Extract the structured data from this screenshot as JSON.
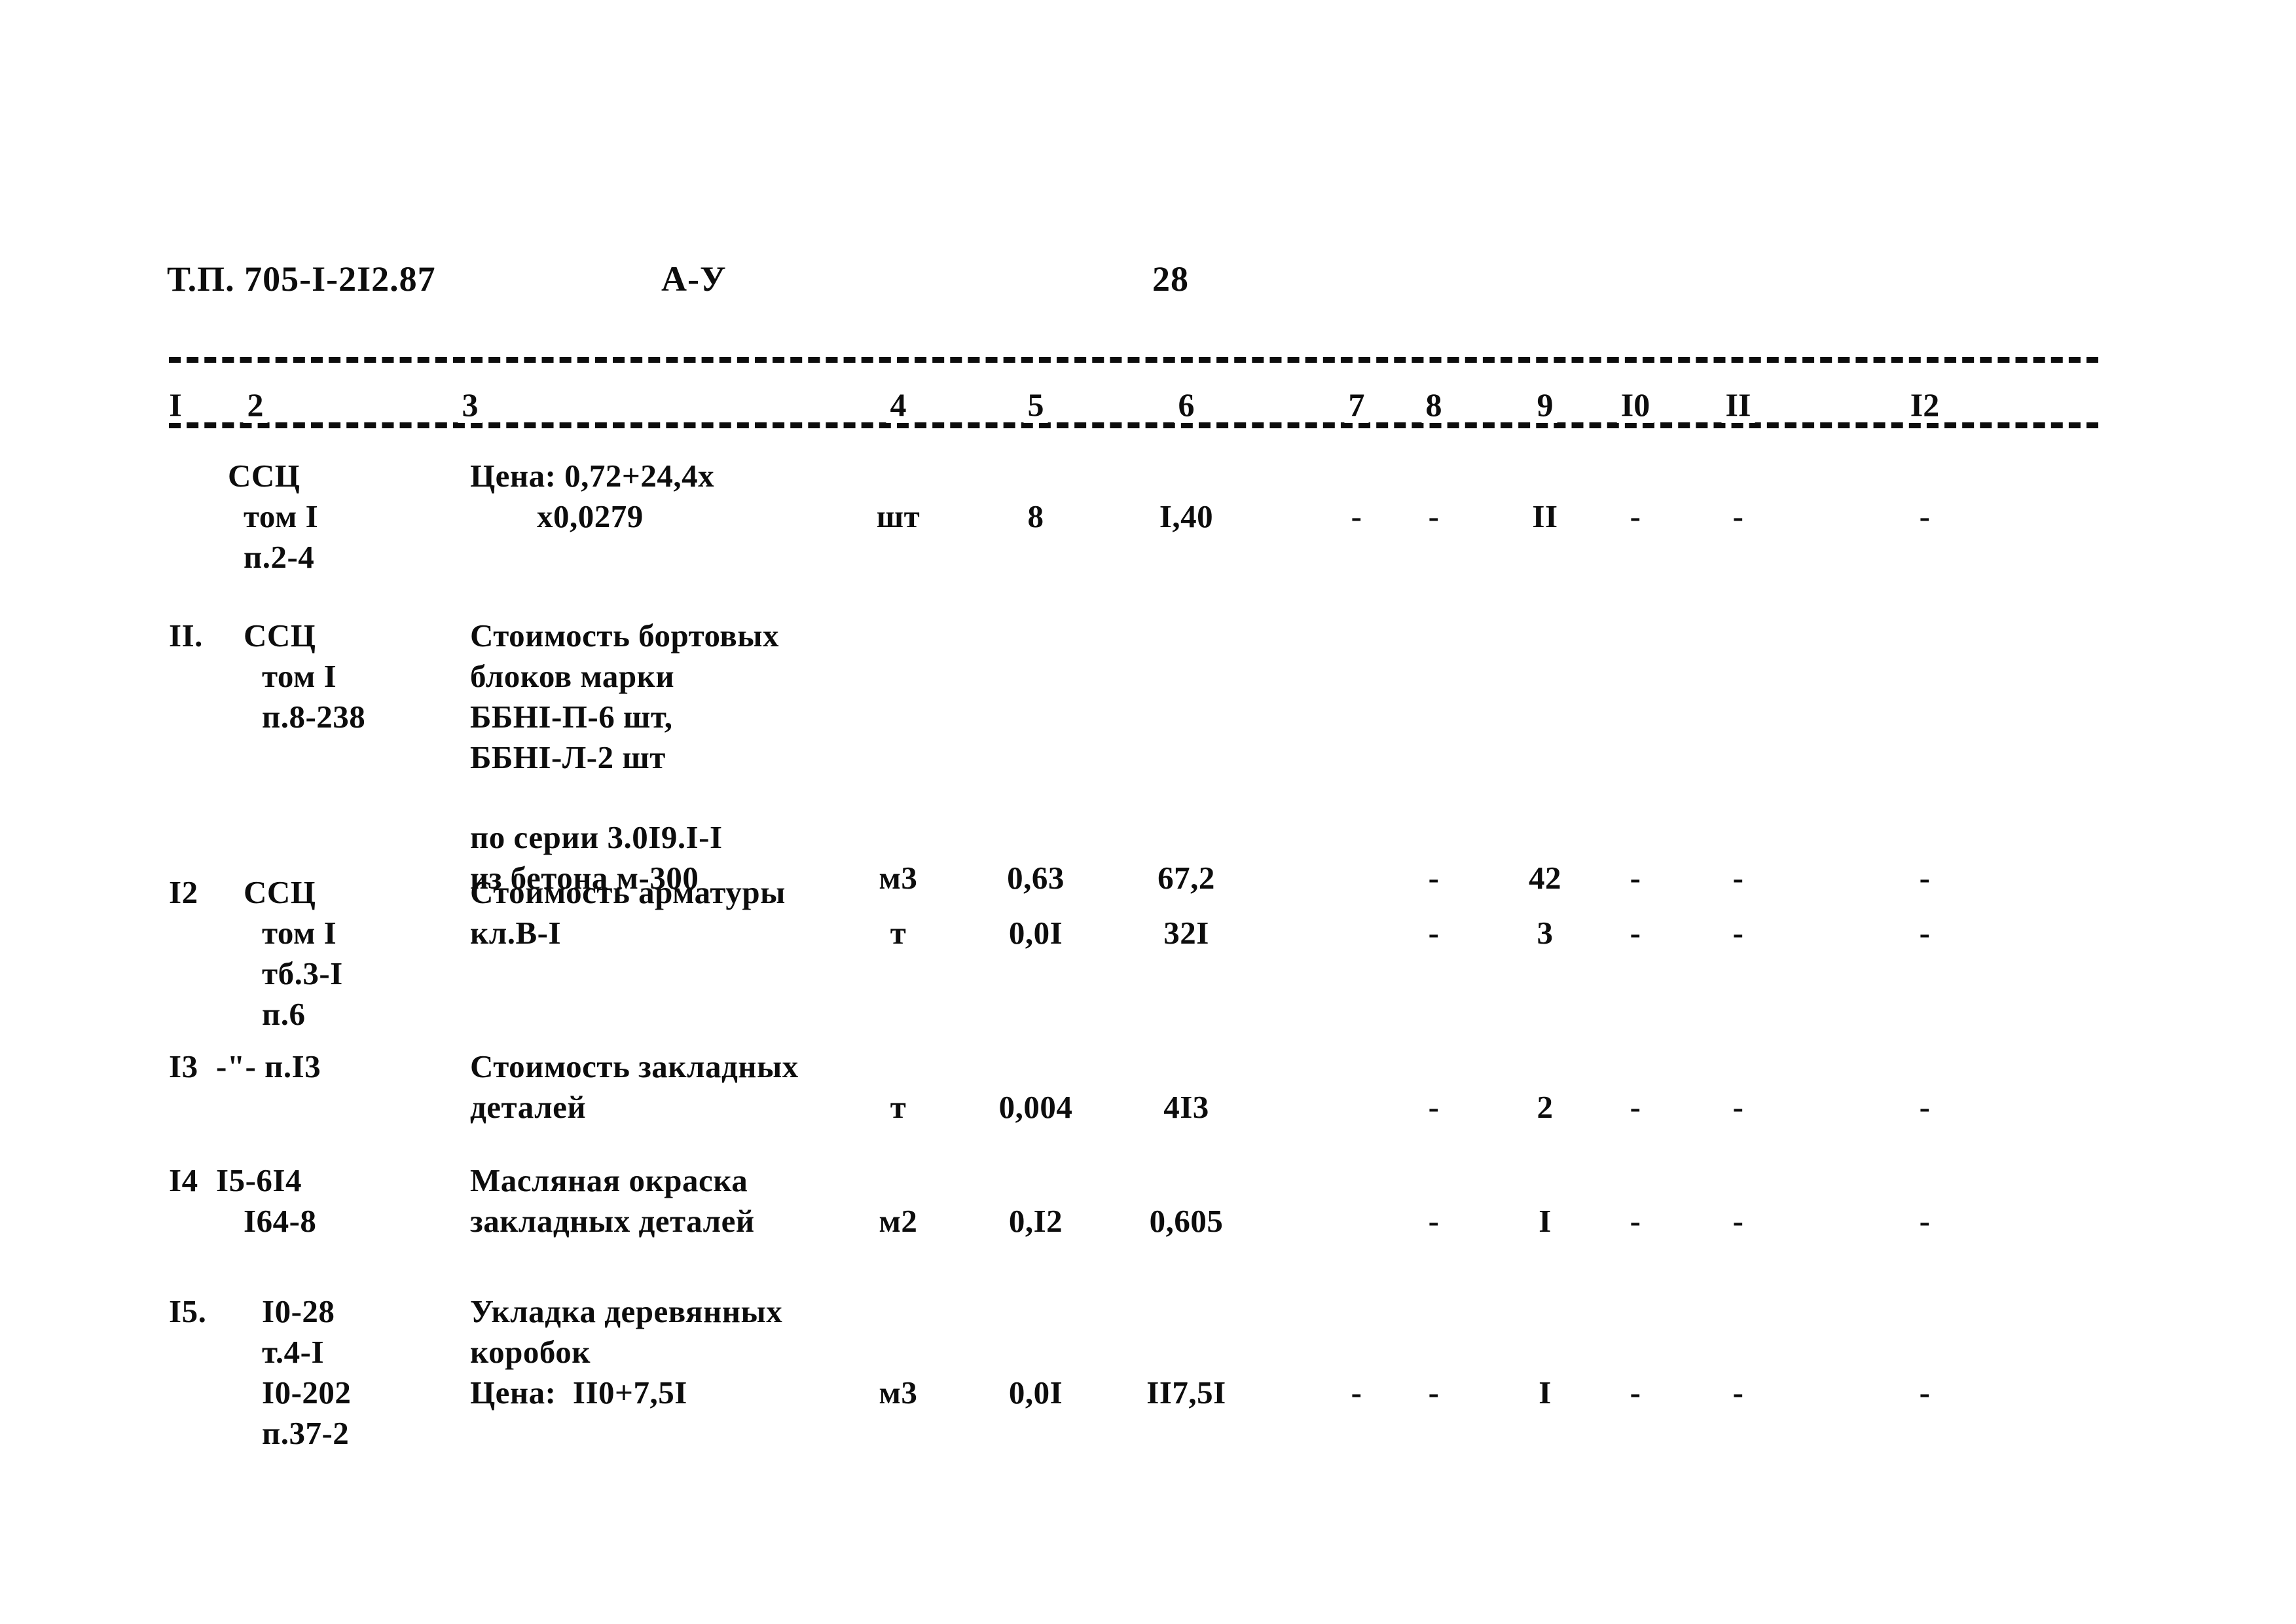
{
  "header": {
    "doc_code": "Т.П. 705-I-2I2.87",
    "sheet_mark": "А-У",
    "page_number": "28"
  },
  "table": {
    "column_headers": [
      "I",
      "2",
      "3",
      "4",
      "5",
      "6",
      "7",
      "8",
      "9",
      "I0",
      "II",
      "I2"
    ],
    "rows": [
      {
        "col1": "",
        "col2": [
          "ССЦ",
          "том I",
          "п.2-4"
        ],
        "col3": [
          "Цена: 0,72+24,4х",
          "        х0,0279"
        ],
        "col4": "шт",
        "col5": "8",
        "col6": "I,40",
        "col7": "-",
        "col8": "-",
        "col9": "II",
        "col10": "-",
        "col11": "-",
        "col12": "-"
      },
      {
        "col1": "II.",
        "col2": [
          "ССЦ",
          "том I",
          "п.8-238"
        ],
        "col3": [
          "Стоимость бортовых",
          "блоков марки",
          "ББHI-П-6 шт,",
          "ББHI-Л-2 шт"
        ],
        "col3_cont": [
          "по серии 3.0I9.I-I",
          "из бетона м-300"
        ],
        "col4": "м3",
        "col5": "0,63",
        "col6": "67,2",
        "col7": "",
        "col8": "-",
        "col9": "42",
        "col10": "-",
        "col11": "-",
        "col12": "-"
      },
      {
        "col1": "I2",
        "col2": [
          "ССЦ",
          "том I",
          "тб.3-I",
          "п.6"
        ],
        "col3": [
          "Стоимость арматуры",
          "кл.В-I"
        ],
        "col4": "т",
        "col5": "0,0I",
        "col6": "32I",
        "col7": "",
        "col8": "-",
        "col9": "3",
        "col10": "-",
        "col11": "-",
        "col12": "-"
      },
      {
        "col1": "I3",
        "col2": [
          "-\"- п.I3"
        ],
        "col3": [
          "Стоимость закладных",
          "деталей"
        ],
        "col4": "т",
        "col5": "0,004",
        "col6": "4I3",
        "col7": "",
        "col8": "-",
        "col9": "2",
        "col10": "-",
        "col11": "-",
        "col12": "-"
      },
      {
        "col1": "I4",
        "col2": [
          "I5-6I4",
          "I64-8"
        ],
        "col3": [
          "Масляная окраска",
          "закладных деталей"
        ],
        "col4": "м2",
        "col5": "0,I2",
        "col6": "0,605",
        "col7": "",
        "col8": "-",
        "col9": "I",
        "col10": "-",
        "col11": "-",
        "col12": "-"
      },
      {
        "col1": "I5.",
        "col2": [
          "I0-28",
          "т.4-I",
          "I0-202",
          "п.37-2"
        ],
        "col3": [
          "Укладка деревянных",
          "коробок",
          "Цена:  II0+7,5I"
        ],
        "col4": "м3",
        "col5": "0,0I",
        "col6": "II7,5I",
        "col7": "-",
        "col8": "-",
        "col9": "I",
        "col10": "-",
        "col11": "-",
        "col12": "-"
      }
    ]
  }
}
